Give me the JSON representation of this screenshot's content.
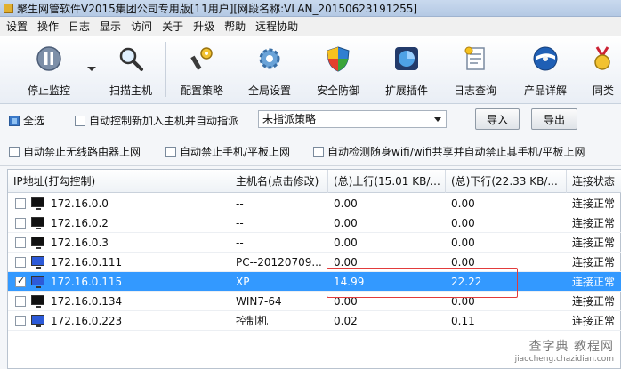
{
  "window": {
    "title": "聚生网管软件V2015集团公司专用版[11用户][网段名称:VLAN_20150623191255]"
  },
  "menu": {
    "items": [
      "设置",
      "操作",
      "日志",
      "显示",
      "访问",
      "关于",
      "升级",
      "帮助",
      "远程协助"
    ]
  },
  "toolbar": {
    "stop_monitor": "停止监控",
    "scan_host": "扫描主机",
    "config_policy": "配置策略",
    "global_settings": "全局设置",
    "security": "安全防御",
    "plugins": "扩展插件",
    "log_query": "日志查询",
    "product_details": "产品详解",
    "peer": "同类"
  },
  "options": {
    "select_all": "全选",
    "auto_control": "自动控制新加入主机并自动指派",
    "policy_select": "未指派策略",
    "import": "导入",
    "export": "导出",
    "ban_wireless_router": "自动禁止无线路由器上网",
    "ban_phone": "自动禁止手机/平板上网",
    "detect_portable_wifi": "自动检测随身wifi/wifi共享并自动禁止其手机/平板上网",
    "colors": {
      "accent": "#3399ff",
      "highlight": "#e23b3b"
    }
  },
  "table": {
    "headers": [
      "IP地址(打勾控制)",
      "主机名(点击修改)",
      "(总)上行(15.01 KB/...",
      "(总)下行(22.33 KB/...",
      "连接状态"
    ],
    "rows": [
      {
        "ip": "172.16.0.0",
        "host": "--",
        "up": "0.00",
        "down": "0.00",
        "status": "连接正常",
        "checked": false,
        "selected": false,
        "monitor": "black"
      },
      {
        "ip": "172.16.0.2",
        "host": "--",
        "up": "0.00",
        "down": "0.00",
        "status": "连接正常",
        "checked": false,
        "selected": false,
        "monitor": "black"
      },
      {
        "ip": "172.16.0.3",
        "host": "--",
        "up": "0.00",
        "down": "0.00",
        "status": "连接正常",
        "checked": false,
        "selected": false,
        "monitor": "black"
      },
      {
        "ip": "172.16.0.111",
        "host": "PC--20120709...",
        "up": "0.00",
        "down": "0.00",
        "status": "连接正常",
        "checked": false,
        "selected": false,
        "monitor": "blue"
      },
      {
        "ip": "172.16.0.115",
        "host": "XP",
        "up": "14.99",
        "down": "22.22",
        "status": "连接正常",
        "checked": true,
        "selected": true,
        "monitor": "blue"
      },
      {
        "ip": "172.16.0.134",
        "host": "WIN7-64",
        "up": "0.00",
        "down": "0.00",
        "status": "连接正常",
        "checked": false,
        "selected": false,
        "monitor": "black"
      },
      {
        "ip": "172.16.0.223",
        "host": "控制机",
        "up": "0.02",
        "down": "0.11",
        "status": "连接正常",
        "checked": false,
        "selected": false,
        "monitor": "blue"
      }
    ]
  },
  "watermark": {
    "line1": "查字典 教程网",
    "line2": "jiaocheng.chazidian.com"
  }
}
